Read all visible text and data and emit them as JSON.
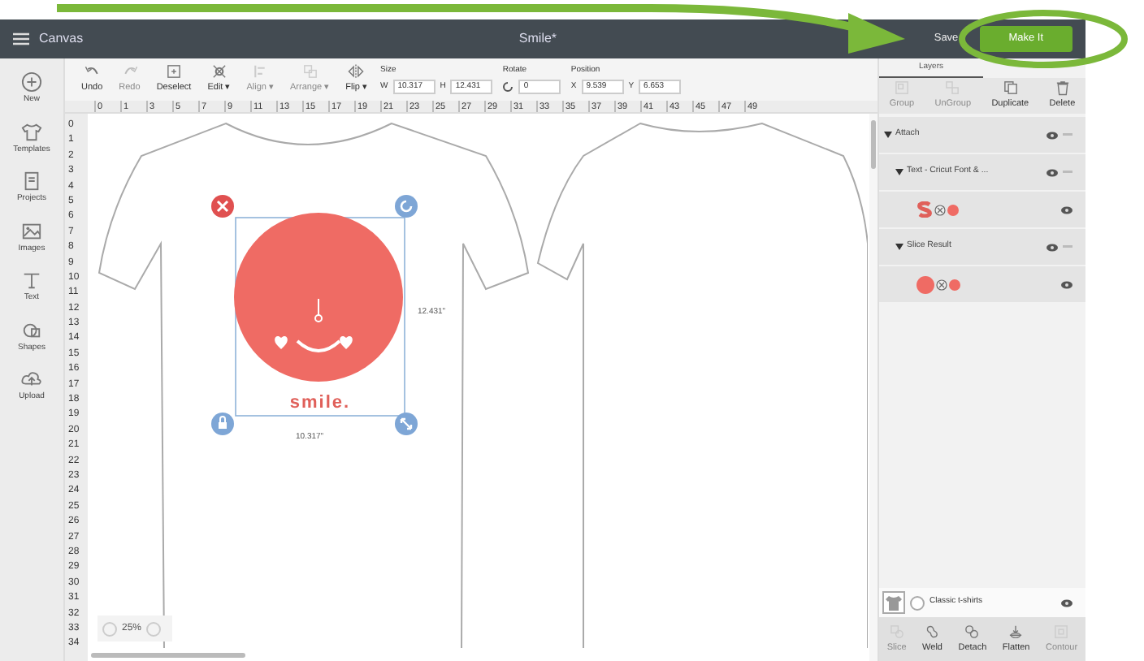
{
  "header": {
    "menu_title": "Canvas",
    "document_title": "Smile*",
    "buttons": [
      {
        "label": "Save",
        "kind": "link"
      },
      {
        "label": "Make It",
        "kind": "primary"
      }
    ]
  },
  "sidebar": [
    {
      "label": "New",
      "kind": "plus"
    },
    {
      "label": "Templates",
      "kind": "shirt"
    },
    {
      "label": "Projects",
      "kind": "book"
    },
    {
      "label": "Images",
      "kind": "image"
    },
    {
      "label": "Text",
      "kind": "text"
    },
    {
      "label": "Shapes",
      "kind": "shapes"
    },
    {
      "label": "Upload",
      "kind": "cloud"
    }
  ],
  "toolbar": [
    {
      "label": "Undo",
      "kind": "undo",
      "disabled": false
    },
    {
      "label": "Redo",
      "kind": "redo",
      "disabled": true
    },
    {
      "label": "Deselect",
      "kind": "select",
      "disabled": false
    },
    {
      "label": "Edit ▾",
      "kind": "edit",
      "disabled": false
    },
    {
      "label": "Align ▾",
      "kind": "align",
      "disabled": true
    },
    {
      "label": "Arrange ▾",
      "kind": "arrange",
      "disabled": true
    },
    {
      "label": "Flip ▾",
      "kind": "flip",
      "disabled": false
    }
  ],
  "size": {
    "label": "Size",
    "fields": [
      {
        "prefix": "W",
        "value": "10.317"
      },
      {
        "prefix": "H",
        "value": "12.431"
      }
    ]
  },
  "rotate": {
    "label": "Rotate",
    "value": "0"
  },
  "position": {
    "label": "Position",
    "fields": [
      {
        "prefix": "X",
        "value": "9.539"
      },
      {
        "prefix": "Y",
        "value": "6.653"
      }
    ]
  },
  "rulers": {
    "horizontal": [
      "0",
      "1",
      "3",
      "5",
      "7",
      "9",
      "11",
      "13",
      "15",
      "17",
      "19",
      "21",
      "23",
      "25",
      "27",
      "29",
      "31",
      "33",
      "35",
      "37",
      "39",
      "41",
      "43",
      "45",
      "47",
      "49"
    ],
    "vertical": [
      "0",
      "1",
      "2",
      "3",
      "4",
      "5",
      "6",
      "7",
      "8",
      "9",
      "10",
      "11",
      "12",
      "13",
      "14",
      "15",
      "16",
      "17",
      "18",
      "19",
      "20",
      "21",
      "22",
      "23",
      "24",
      "25",
      "26",
      "27",
      "28",
      "29",
      "30",
      "31",
      "32",
      "33",
      "34"
    ]
  },
  "canvas": {
    "design_text": "smile.",
    "height_label": "12.431\"",
    "width_label": "10.317\"",
    "zoom": "25%"
  },
  "layers_panel": {
    "tabs": [
      {
        "label": "Layers",
        "selected": true
      }
    ],
    "tools": [
      {
        "label": "Group",
        "kind": "group",
        "disabled": true
      },
      {
        "label": "UnGroup",
        "kind": "ungroup",
        "disabled": true
      },
      {
        "label": "Duplicate",
        "kind": "duplicate",
        "disabled": false
      },
      {
        "label": "Delete",
        "kind": "delete",
        "disabled": false
      }
    ],
    "tree": [
      {
        "label": "Attach",
        "expanded": true,
        "children": [
          {
            "label": "Text - Cricut Font & ...",
            "expanded": true,
            "children": [
              {
                "kind": "letter"
              }
            ]
          },
          {
            "label": "Slice Result",
            "expanded": true,
            "children": [
              {
                "kind": "circle"
              }
            ]
          }
        ]
      }
    ],
    "canvas_item": {
      "label": "Classic t-shirts",
      "selected": false
    },
    "actions": [
      {
        "label": "Slice",
        "kind": "slice",
        "disabled": true
      },
      {
        "label": "Weld",
        "kind": "weld",
        "disabled": false
      },
      {
        "label": "Detach",
        "kind": "detach",
        "disabled": false
      },
      {
        "label": "Flatten",
        "kind": "flatten",
        "disabled": false
      },
      {
        "label": "Contour",
        "kind": "contour",
        "disabled": true
      }
    ]
  }
}
